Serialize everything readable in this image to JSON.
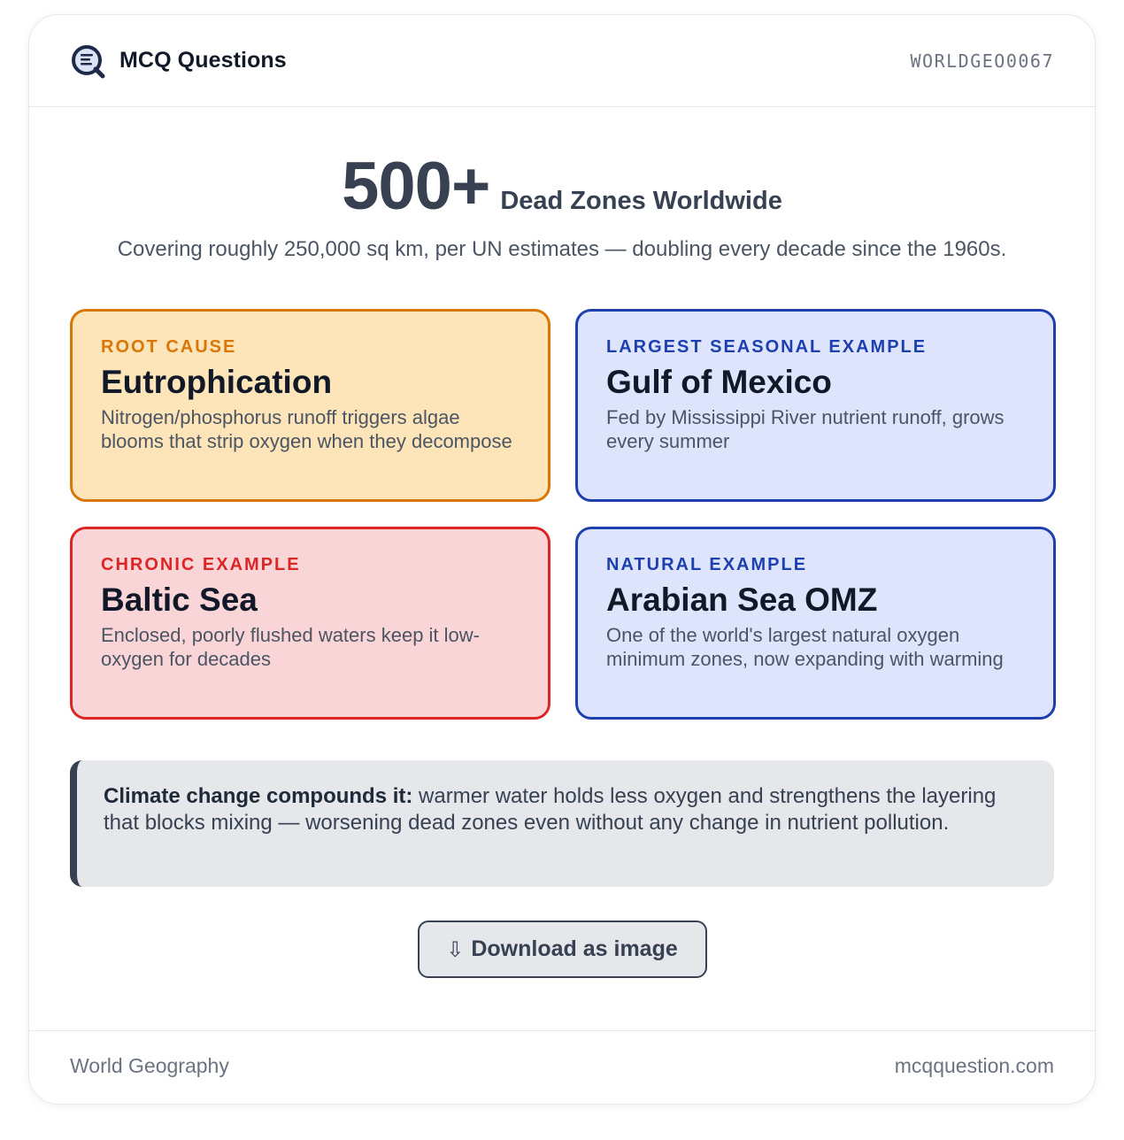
{
  "header": {
    "brand": "MCQ Questions",
    "code": "WORLDGEO0067",
    "logo_icon": "magnifier-q-logo-icon"
  },
  "hero": {
    "stat": "500+",
    "label": "Dead Zones Worldwide",
    "subtitle": "Covering roughly 250,000 sq km, per UN estimates — doubling every decade since the 1960s."
  },
  "tiles": [
    {
      "eyebrow": "ROOT CAUSE",
      "title": "Eutrophication",
      "desc": "Nitrogen/phosphorus runoff triggers algae blooms that strip oxygen when they decompose",
      "color": "#d97706"
    },
    {
      "eyebrow": "LARGEST SEASONAL EXAMPLE",
      "title": "Gulf of Mexico",
      "desc": "Fed by Mississippi River nutrient runoff, grows every summer",
      "color": "#1e40af"
    },
    {
      "eyebrow": "CHRONIC EXAMPLE",
      "title": "Baltic Sea",
      "desc": "Enclosed, poorly flushed waters keep it low-oxygen for decades",
      "color": "#dc2626"
    },
    {
      "eyebrow": "NATURAL EXAMPLE",
      "title": "Arabian Sea OMZ",
      "desc": "One of the world's largest natural oxygen minimum zones, now expanding with warming",
      "color": "#1e40af"
    }
  ],
  "callout": {
    "lead": "Climate change compounds it:",
    "text": " warmer water holds less oxygen and strengthens the layering that blocks mixing — worsening dead zones even without any change in nutrient pollution."
  },
  "download": {
    "icon": "⇩",
    "label": "Download as image"
  },
  "footer": {
    "category": "World Geography",
    "site": "mcqquestion.com"
  }
}
